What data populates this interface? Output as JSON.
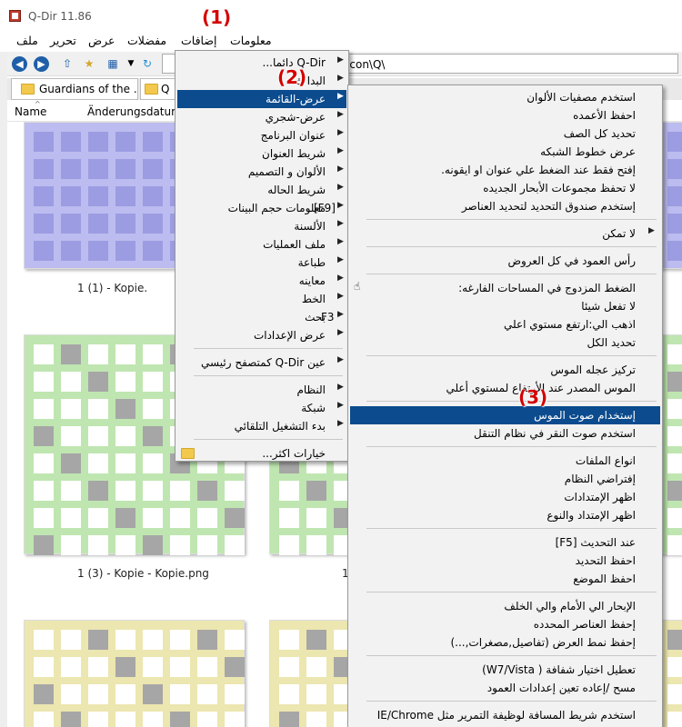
{
  "app": {
    "title": "Q-Dir 11.86"
  },
  "menubar": {
    "items": [
      "ملف",
      "تحرير",
      "عرض",
      "مفضلات",
      "إضافات",
      "معلومات"
    ]
  },
  "address": {
    "path": "\\icon\\Q\\"
  },
  "tabs": [
    "Guardians of the ...",
    "Q"
  ],
  "columns": [
    "Name",
    "Änderungsdatum"
  ],
  "thumbs": {
    "labels": [
      "1 (1) - Kopie.",
      "1 (3) - Kopie - Kopie.png",
      "1"
    ]
  },
  "annotations": [
    "(1)",
    "(2)",
    "(3)"
  ],
  "menu1": {
    "items": [
      {
        "label": "Q-Dir دائما...",
        "arrow": true
      },
      {
        "label": "البدا ك..",
        "arrow": true
      },
      {
        "label": "عرض-القائمة",
        "arrow": true,
        "highlight": true
      },
      {
        "label": "عرض-شجري",
        "arrow": true
      },
      {
        "label": "عنوان البرنامج",
        "arrow": true
      },
      {
        "label": "شريط العنوان",
        "arrow": true
      },
      {
        "label": "الألوان و التصميم",
        "arrow": true
      },
      {
        "label": "شريط الحاله",
        "arrow": true
      },
      {
        "label": "معلومات حجم البينات",
        "shortcut": "[F9]",
        "arrow": true
      },
      {
        "label": "الألسنة",
        "arrow": true
      },
      {
        "label": "ملف العمليات",
        "arrow": true
      },
      {
        "label": "طباعة",
        "arrow": true
      },
      {
        "label": "معاينه",
        "arrow": true
      },
      {
        "label": "الخط",
        "arrow": true
      },
      {
        "label": "بحث",
        "shortcut": "F3",
        "arrow": true
      },
      {
        "label": "عرض الإعدادات",
        "arrow": true
      },
      {
        "label": "عين Q-Dir كمتصفح رئيسي",
        "arrow": true
      },
      {
        "label": "النظام",
        "arrow": true
      },
      {
        "label": "شبكة",
        "arrow": true
      },
      {
        "label": "بدء التشغيل التلقائي",
        "arrow": true
      },
      {
        "label": "خيارات اكثر...",
        "arrow": false
      }
    ]
  },
  "menu2": {
    "items": [
      "استخدم مصفيات الألوان",
      "احفظ الأعمده",
      "تحديد كل الصف",
      "عرض خطوط الشبكه",
      "إفتح فقط عند الضغط علي عنوان او ايقونه.",
      "لا تحفظ مجموعات الأبحار الجديده",
      "إستخدم صندوق التحديد لتحديد العناصر",
      "لا تمكن",
      "رأس العمود في كل العروض",
      "الضغط المزدوج في المساحات الفارغه:",
      "لا تفعل شيئا",
      "اذهب الي:ارتفع مستوي اعلي",
      "تحديد الكل",
      "تركيز عجله الموس",
      "الموس المصدر عند الأرتفاع لمستوي أعلي",
      "إستخدام صوت الموس",
      "استخدم صوت النقر في نظام التنقل",
      "انواع الملفات",
      "إفتراضي النظام",
      "اظهر الإمتدادات",
      "اظهر الإمتداد والنوع",
      "عند التحديث [F5]",
      "احفظ التحديد",
      "احفظ الموضع",
      "الإبحار الي الأمام والي الخلف",
      "إحفظ العناصر المحدده",
      "إحفظ نمط العرض (تفاصيل,مصغرات,...)",
      "تعطيل اختيار شفافة ( W7/Vista)",
      "مسح /إعاده تعين إعدادات العمود",
      "استخدم شريط المسافة لوظيفة التمرير مثل IE/Chrome"
    ]
  }
}
